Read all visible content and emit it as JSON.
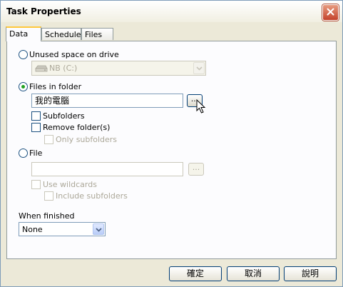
{
  "window": {
    "title": "Task Properties",
    "close_icon": "close-icon"
  },
  "tabs": [
    {
      "label": "Data",
      "active": true
    },
    {
      "label": "Schedule",
      "active": false
    },
    {
      "label": "Files",
      "active": false
    }
  ],
  "options": {
    "unused_space": {
      "label": "Unused space on drive",
      "selected": false
    },
    "drive_select": {
      "value": "NB (C:)",
      "enabled": false
    },
    "files_in_folder": {
      "label": "Files in folder",
      "selected": true
    },
    "folder_path": {
      "value": "我的電腦"
    },
    "browse_label": "...",
    "subfolders": {
      "label": "Subfolders",
      "checked": false
    },
    "remove_folders": {
      "label": "Remove folder(s)",
      "checked": false
    },
    "only_subfolders": {
      "label": "Only subfolders",
      "checked": false,
      "enabled": false
    },
    "file": {
      "label": "File",
      "selected": false
    },
    "file_path": {
      "value": "",
      "enabled": false
    },
    "file_browse_label": "...",
    "use_wildcards": {
      "label": "Use wildcards",
      "checked": false,
      "enabled": false
    },
    "include_subfolders": {
      "label": "Include subfolders",
      "checked": false,
      "enabled": false
    }
  },
  "when_finished": {
    "label": "When finished",
    "value": "None"
  },
  "buttons": {
    "ok": "確定",
    "cancel": "取消",
    "help": "說明"
  },
  "colors": {
    "radio_dot": "#21a121",
    "tab_highlight": "#ffc83c",
    "close_red": "#c4422b"
  }
}
